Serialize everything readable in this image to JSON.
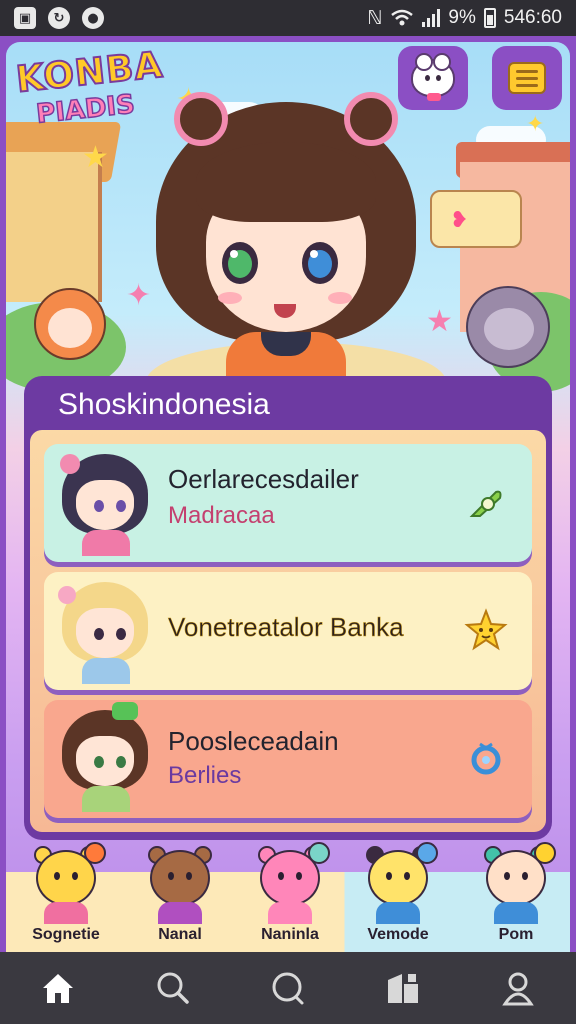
{
  "status_bar": {
    "battery": "9%",
    "time": "546:60",
    "icons": [
      "gallery-icon",
      "sync-icon",
      "notification-icon",
      "mute-icon",
      "wifi-icon",
      "signal-icon",
      "battery-icon"
    ]
  },
  "header": {
    "logo_line1": "KONBA",
    "logo_line2": "PIADIS",
    "pet_button_icon": "pet-face-icon",
    "menu_button_icon": "notes-menu-icon"
  },
  "panel": {
    "title": "Shoskindonesia",
    "items": [
      {
        "title": "Oerlarecesdailer",
        "subtitle": "Madracaa",
        "subtitle_color": "#c4406f",
        "action_icon": "leaf-tag-icon",
        "background": "#c8f1e4"
      },
      {
        "title": "Vonetreatalor Banka",
        "subtitle": "",
        "subtitle_color": "#2b2020",
        "action_icon": "star-icon",
        "background": "#fdf1c4"
      },
      {
        "title": "Poosleceadain",
        "subtitle": "Berlies",
        "subtitle_color": "#6a3aa0",
        "action_icon": "ring-icon",
        "background": "#f9a78e"
      }
    ]
  },
  "friends": [
    {
      "name": "Sognetie",
      "color": "#ffd54a"
    },
    {
      "name": "Nanal",
      "color": "#a66a44"
    },
    {
      "name": "Naninla",
      "color": "#ff86b9"
    },
    {
      "name": "Vemode",
      "color": "#ffe36a"
    },
    {
      "name": "Pom",
      "color": "#ffe0c8"
    }
  ],
  "nav": [
    "home-icon",
    "search-icon",
    "explore-icon",
    "shop-icon",
    "profile-icon"
  ],
  "colors": {
    "accent": "#8b4fc4",
    "panel": "#6d3aa2",
    "highlight": "#ffc92e"
  }
}
